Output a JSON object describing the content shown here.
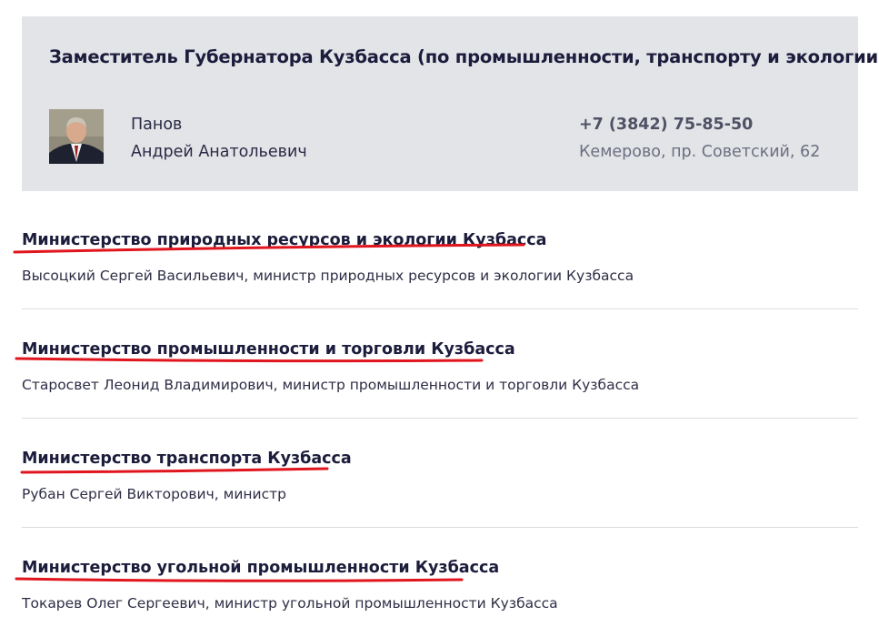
{
  "deputy": {
    "title": "Заместитель Губернатора Кузбасса (по промышленности, транспорту и экологии)",
    "surname": "Панов",
    "given_names": "Андрей Анатольевич",
    "phone": "+7 (3842) 75-85-50",
    "address": "Кемерово, пр. Советский, 62"
  },
  "ministries": [
    {
      "title": "Министерство природных ресурсов и экологии Кузбасса",
      "head": "Высоцкий Сергей Васильевич, министр природных ресурсов и экологии Кузбасса"
    },
    {
      "title": "Министерство промышленности и торговли Кузбасса",
      "head": "Старосвет Леонид Владимирович, министр промышленности и торговли Кузбасса"
    },
    {
      "title": "Министерство транспорта Кузбасса",
      "head": "Рубан Сергей Викторович, министр"
    },
    {
      "title": "Министерство угольной промышленности Кузбасса",
      "head": "Токарев Олег Сергеевич, министр угольной промышленности Кузбасса"
    }
  ],
  "colors": {
    "card_bg": "#e3e4e8",
    "annotation_underline": "#e0151d",
    "divider": "#dcdde1"
  }
}
